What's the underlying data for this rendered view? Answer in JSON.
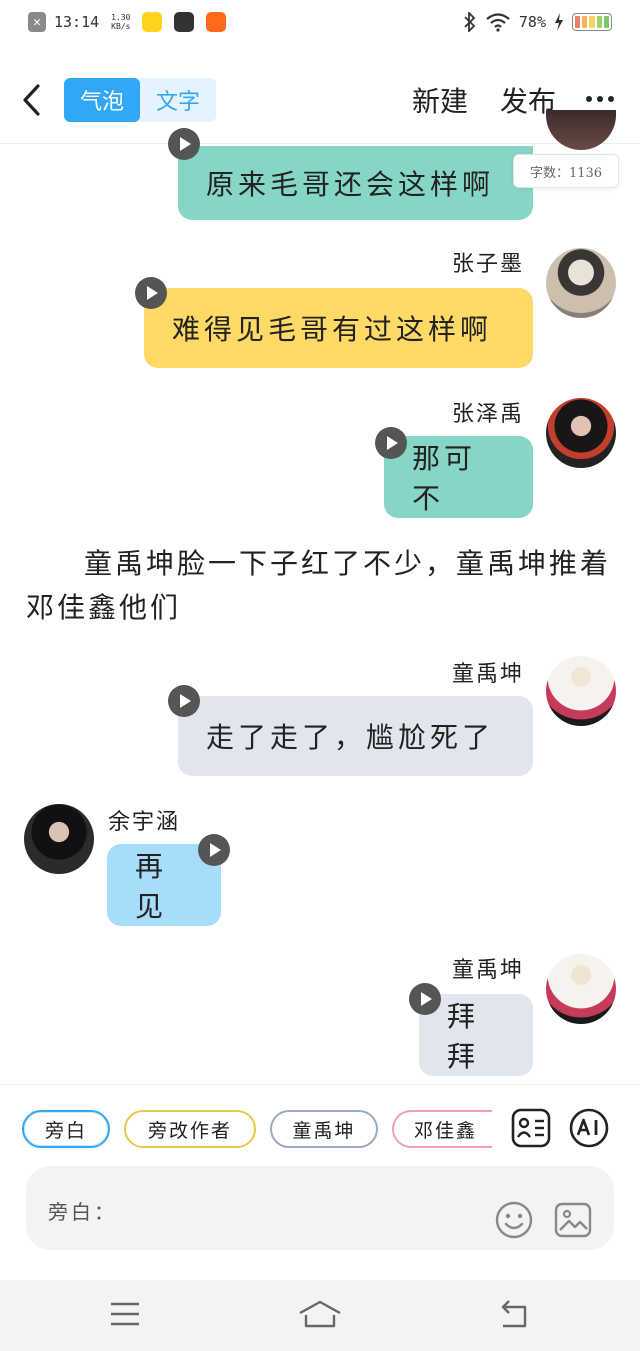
{
  "status_bar": {
    "time": "13:14",
    "net_speed_value": "1.30",
    "net_speed_unit": "KB/s",
    "battery": "78%"
  },
  "header": {
    "tab_bubble": "气泡",
    "tab_text": "文字",
    "new_label": "新建",
    "publish_label": "发布"
  },
  "word_count": "字数：1136",
  "messages": [
    {
      "text": "原来毛哥还会这样啊",
      "color": "#86d6c8"
    },
    {
      "name": "张子墨",
      "text": "难得见毛哥有过这样啊",
      "color": "#ffd966"
    },
    {
      "name": "张泽禹",
      "text": "那可不",
      "color": "#86d6c8"
    },
    {
      "name": "童禹坤",
      "text": "走了走了，尴尬死了",
      "color": "#e0e5ee"
    },
    {
      "name": "余宇涵",
      "text": "再见",
      "color": "#a8dcfb"
    },
    {
      "name": "童禹坤",
      "text": "拜拜",
      "color": "#e0e5ee"
    }
  ],
  "narration": "童禹坤脸一下子红了不少，童禹坤推着邓佳鑫他们",
  "roles": [
    {
      "label": "旁白",
      "border": "#31a8f5"
    },
    {
      "label": "旁改作者",
      "border": "#e8c94a"
    },
    {
      "label": "童禹坤",
      "border": "#9aa9be"
    },
    {
      "label": "邓佳鑫",
      "border": "#f0a0b0"
    }
  ],
  "input": {
    "label": "旁白："
  },
  "icons": {
    "back": "back-arrow-icon",
    "more": "more-dots-icon",
    "role_card": "role-card-icon",
    "ai": "ai-icon",
    "emoji": "emoji-icon",
    "image": "image-icon",
    "menu": "menu-icon",
    "home": "home-icon",
    "return": "return-icon"
  },
  "colors": {
    "accent": "#31a8f5",
    "teal_bubble": "#86d6c8",
    "yellow_bubble": "#ffd966",
    "gray_bubble": "#e0e5ee",
    "blue_bubble": "#a8dcfb"
  }
}
